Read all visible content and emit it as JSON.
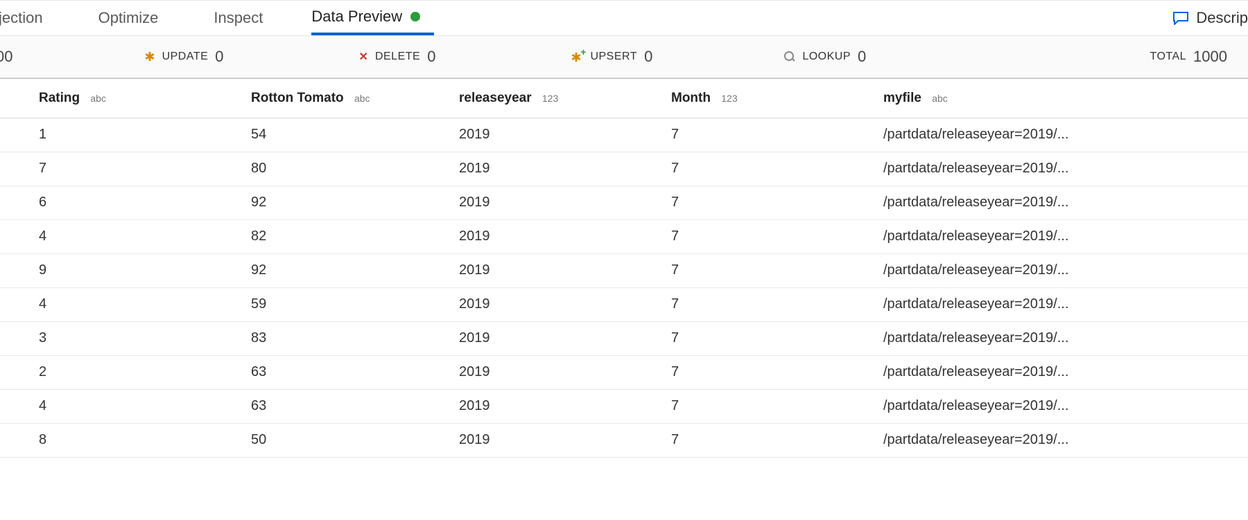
{
  "tabs": {
    "partial_left": "jection",
    "optimize": "Optimize",
    "inspect": "Inspect",
    "data_preview": "Data Preview",
    "active_has_dot": true
  },
  "right_action": {
    "label": "Descrip"
  },
  "stats": {
    "partial_left_value": "00",
    "update": {
      "label": "UPDATE",
      "value": "0"
    },
    "delete": {
      "label": "DELETE",
      "value": "0"
    },
    "upsert": {
      "label": "UPSERT",
      "value": "0"
    },
    "lookup": {
      "label": "LOOKUP",
      "value": "0"
    },
    "total": {
      "label": "TOTAL",
      "value": "1000"
    }
  },
  "table": {
    "columns": [
      {
        "name": "Rating",
        "type": "abc"
      },
      {
        "name": "Rotton Tomato",
        "type": "abc"
      },
      {
        "name": "releaseyear",
        "type": "123"
      },
      {
        "name": "Month",
        "type": "123"
      },
      {
        "name": "myfile",
        "type": "abc"
      }
    ],
    "rows": [
      {
        "rating": "1",
        "rotton": "54",
        "year": "2019",
        "month": "7",
        "myfile": "/partdata/releaseyear=2019/..."
      },
      {
        "rating": "7",
        "rotton": "80",
        "year": "2019",
        "month": "7",
        "myfile": "/partdata/releaseyear=2019/..."
      },
      {
        "rating": "6",
        "rotton": "92",
        "year": "2019",
        "month": "7",
        "myfile": "/partdata/releaseyear=2019/..."
      },
      {
        "rating": "4",
        "rotton": "82",
        "year": "2019",
        "month": "7",
        "myfile": "/partdata/releaseyear=2019/..."
      },
      {
        "rating": "9",
        "rotton": "92",
        "year": "2019",
        "month": "7",
        "myfile": "/partdata/releaseyear=2019/..."
      },
      {
        "rating": "4",
        "rotton": "59",
        "year": "2019",
        "month": "7",
        "myfile": "/partdata/releaseyear=2019/..."
      },
      {
        "rating": "3",
        "rotton": "83",
        "year": "2019",
        "month": "7",
        "myfile": "/partdata/releaseyear=2019/..."
      },
      {
        "rating": "2",
        "rotton": "63",
        "year": "2019",
        "month": "7",
        "myfile": "/partdata/releaseyear=2019/..."
      },
      {
        "rating": "4",
        "rotton": "63",
        "year": "2019",
        "month": "7",
        "myfile": "/partdata/releaseyear=2019/..."
      },
      {
        "rating": "8",
        "rotton": "50",
        "year": "2019",
        "month": "7",
        "myfile": "/partdata/releaseyear=2019/..."
      }
    ]
  }
}
